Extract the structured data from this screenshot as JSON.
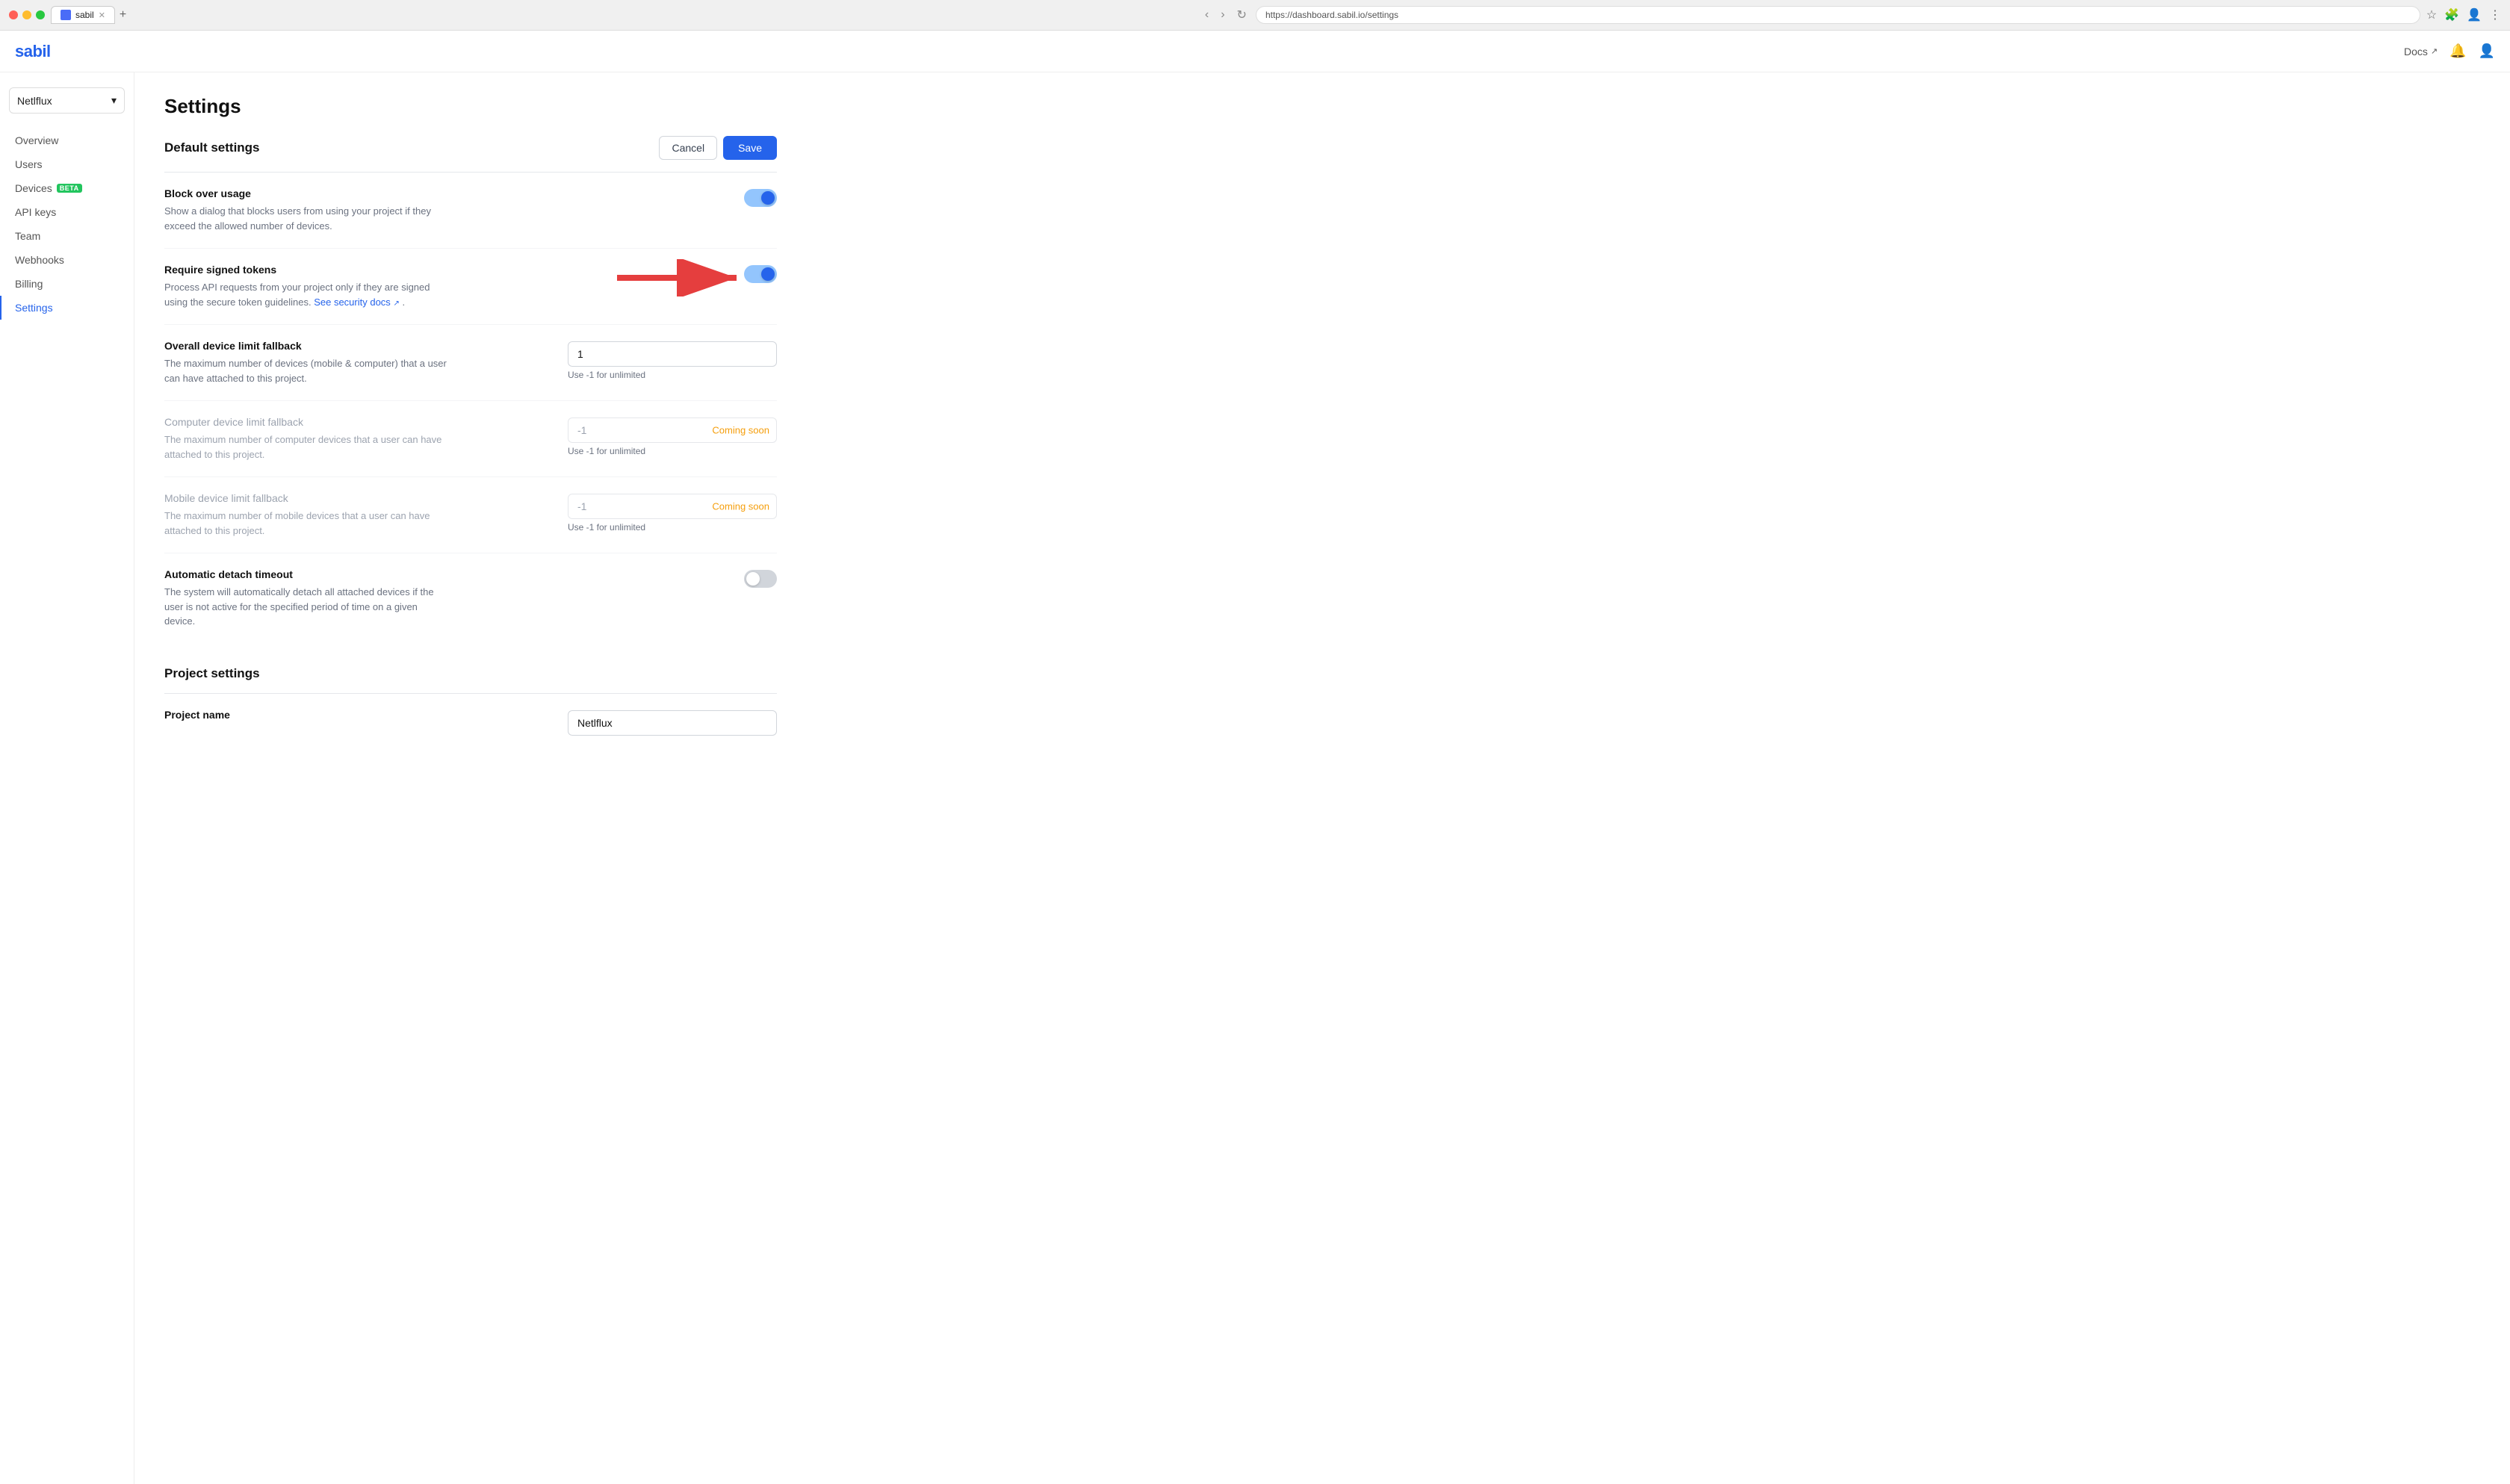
{
  "browser": {
    "url": "https://dashboard.sabil.io/settings",
    "tab_title": "sabil"
  },
  "header": {
    "logo": "sabil",
    "docs_label": "Docs",
    "external_icon": "↗"
  },
  "sidebar": {
    "project_name": "Netlflux",
    "nav_items": [
      {
        "id": "overview",
        "label": "Overview",
        "active": false
      },
      {
        "id": "users",
        "label": "Users",
        "active": false
      },
      {
        "id": "devices",
        "label": "Devices",
        "active": false,
        "badge": "BETA"
      },
      {
        "id": "api-keys",
        "label": "API keys",
        "active": false
      },
      {
        "id": "team",
        "label": "Team",
        "active": false
      },
      {
        "id": "webhooks",
        "label": "Webhooks",
        "active": false
      },
      {
        "id": "billing",
        "label": "Billing",
        "active": false
      },
      {
        "id": "settings",
        "label": "Settings",
        "active": true
      }
    ]
  },
  "page": {
    "title": "Settings",
    "default_settings_label": "Default settings",
    "cancel_label": "Cancel",
    "save_label": "Save",
    "settings": [
      {
        "id": "block-over-usage",
        "label": "Block over usage",
        "desc": "Show a dialog that blocks users from using your project if they exceed the allowed number of devices.",
        "type": "toggle",
        "enabled": true,
        "disabled": false
      },
      {
        "id": "require-signed-tokens",
        "label": "Require signed tokens",
        "desc": "Process API requests from your project only if they are signed using the secure token guidelines.",
        "link_text": "See security docs",
        "link_url": "#",
        "type": "toggle",
        "enabled": true,
        "disabled": false,
        "has_arrow": true
      },
      {
        "id": "overall-device-limit",
        "label": "Overall device limit fallback",
        "desc": "The maximum number of devices (mobile & computer) that a user can have attached to this project.",
        "type": "input",
        "value": "1",
        "hint": "Use -1 for unlimited",
        "disabled": false,
        "coming_soon": false
      },
      {
        "id": "computer-device-limit",
        "label": "Computer device limit fallback",
        "desc": "The maximum number of computer devices that a user can have attached to this project.",
        "type": "input",
        "value": "-1",
        "hint": "Use -1 for unlimited",
        "disabled": true,
        "coming_soon": true,
        "coming_soon_label": "Coming soon"
      },
      {
        "id": "mobile-device-limit",
        "label": "Mobile device limit fallback",
        "desc": "The maximum number of mobile devices that a user can have attached to this project.",
        "type": "input",
        "value": "-1",
        "hint": "Use -1 for unlimited",
        "disabled": true,
        "coming_soon": true,
        "coming_soon_label": "Coming soon"
      },
      {
        "id": "auto-detach-timeout",
        "label": "Automatic detach timeout",
        "desc": "The system will automatically detach all attached devices if the user is not active for the specified period of time on a given device.",
        "type": "toggle",
        "enabled": false,
        "disabled": false
      }
    ],
    "project_settings_label": "Project settings",
    "project_name_label": "Project name",
    "project_name_value": "Netlflux"
  }
}
